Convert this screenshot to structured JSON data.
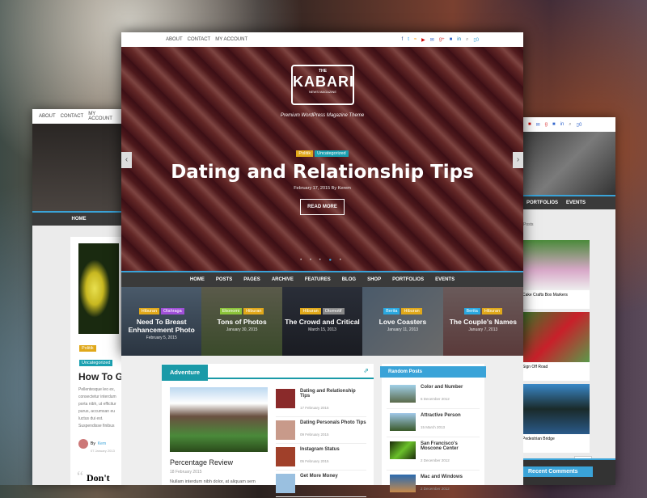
{
  "left": {
    "menu": [
      "ABOUT",
      "CONTACT",
      "MY ACCOUNT"
    ],
    "nav": "HOME",
    "tags": [
      "Politik",
      "Uncategorized"
    ],
    "title": "How To Get Web Traffic",
    "excerpt": "Pellentesque leo ex, consectetur interdum porta nibh, ut efficitur purus, accumsan eu luctus dui est. Suspendisse finibus pellentesque",
    "author_prefix": "By",
    "author": "Kem",
    "date": "07 January 2013",
    "quote": "Don't"
  },
  "top": {
    "menu": [
      "ABOUT",
      "CONTACT",
      "MY ACCOUNT"
    ],
    "cart_count": "0"
  },
  "logo": {
    "the": "THE",
    "name": "KABARI",
    "sub": "NEWS MAGAZINE"
  },
  "hero": {
    "tagline": "Premium WordPress Magazine Theme",
    "tags": [
      "Politik",
      "Uncategorized"
    ],
    "title": "Dating and Relationship Tips",
    "meta": "February 17, 2015 By Kerem",
    "button": "READ MORE",
    "slides": 5,
    "active_slide": 4
  },
  "nav": [
    "HOME",
    "POSTS",
    "PAGES",
    "ARCHIVE",
    "FEATURES",
    "BLOG",
    "SHOP",
    "PORTFOLIOS",
    "EVENTS"
  ],
  "featured": [
    {
      "tags": [
        "Hiburan",
        "Olahraga"
      ],
      "title": "Need To Breast Enhancement Photo",
      "date": "February 5, 2015"
    },
    {
      "tags": [
        "Ekonomi",
        "Hiburan"
      ],
      "title": "Tons of Photos",
      "date": "January 30, 2015"
    },
    {
      "tags": [
        "Hiburan",
        "Otomotif"
      ],
      "title": "The Crowd and Critical",
      "date": "March 15, 2013"
    },
    {
      "tags": [
        "Berita",
        "Hiburan"
      ],
      "title": "Love Coasters",
      "date": "January 11, 2013"
    },
    {
      "tags": [
        "Berita",
        "Hiburan"
      ],
      "title": "The Couple's Names",
      "date": "January 7, 2013"
    }
  ],
  "adventure": {
    "heading": "Adventure",
    "main": {
      "title": "Percentage Review",
      "date": "18 February 2015",
      "excerpt": "Nullam interdum nibh dolor, at aliquam sem"
    },
    "list": [
      {
        "title": "Dating and Relationship Tips",
        "date": "17 February 2015"
      },
      {
        "title": "Dating Personals Photo Tips",
        "date": "09 February 2015"
      },
      {
        "title": "Instagram Status",
        "date": "05 February 2015"
      },
      {
        "title": "Get More Money",
        "date": ""
      }
    ]
  },
  "random": {
    "heading": "Random Posts",
    "items": [
      {
        "title": "Color and Number",
        "date": "6 December 2012"
      },
      {
        "title": "Attractive Person",
        "date": "15 March 2013"
      },
      {
        "title": "San Francisco's Moscone Center",
        "date": "2 December 2012"
      },
      {
        "title": "Mac and Windows",
        "date": "2 December 2012"
      }
    ]
  },
  "right": {
    "nav": [
      "PORTFOLIOS",
      "EVENTS"
    ],
    "label": "Posts",
    "posts": [
      "Cake Crafts Box Markers",
      "Sign Off Road",
      "Pedestrian Bridge"
    ],
    "next": "NEXT »",
    "comments": "Recent Comments"
  },
  "colors": {
    "politik": "#e0a81a",
    "uncategorized": "#1aa0b0",
    "hiburan": "#e0a81a",
    "olahraga": "#a050d8",
    "ekonomi": "#8cc43a",
    "otomotif": "#888888",
    "berita": "#2aa8e0",
    "accent": "#3aa3d8"
  }
}
